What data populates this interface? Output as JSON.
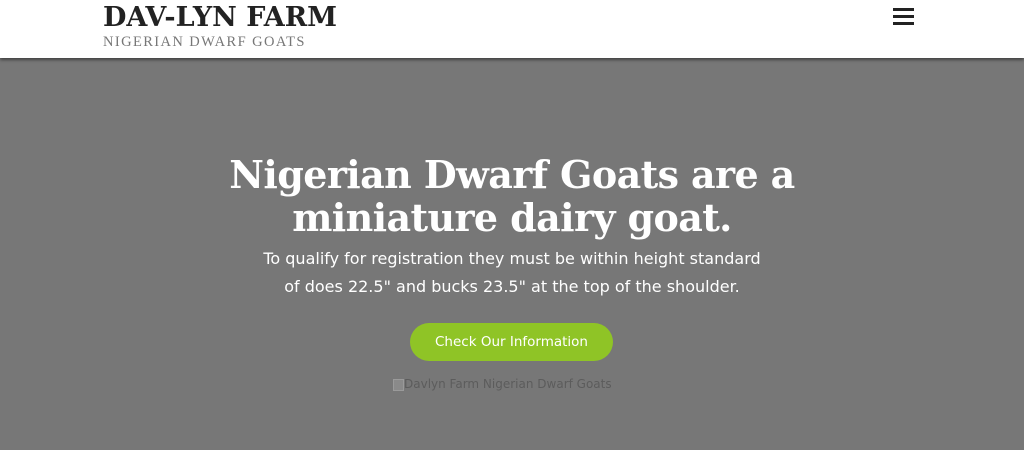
{
  "header": {
    "title": "DAV-LYN FARM",
    "subtitle": "NIGERIAN DWARF GOATS",
    "menu_icon": "hamburger-menu-icon"
  },
  "hero": {
    "headline_line1": "Nigerian Dwarf Goats are a",
    "headline_line2": "miniature dairy goat.",
    "text_line1": "To qualify for registration they must be within height standard",
    "text_line2": "of does 22.5\" and bucks 23.5\" at the top of the shoulder.",
    "cta_label": "Check Our Information",
    "image_alt": "Davlyn Farm Nigerian Dwarf Goats"
  },
  "colors": {
    "header_bg": "#ffffff",
    "hero_bg": "#777777",
    "accent": "#8fc426",
    "title_text": "#222222",
    "subtitle_text": "#777777"
  }
}
